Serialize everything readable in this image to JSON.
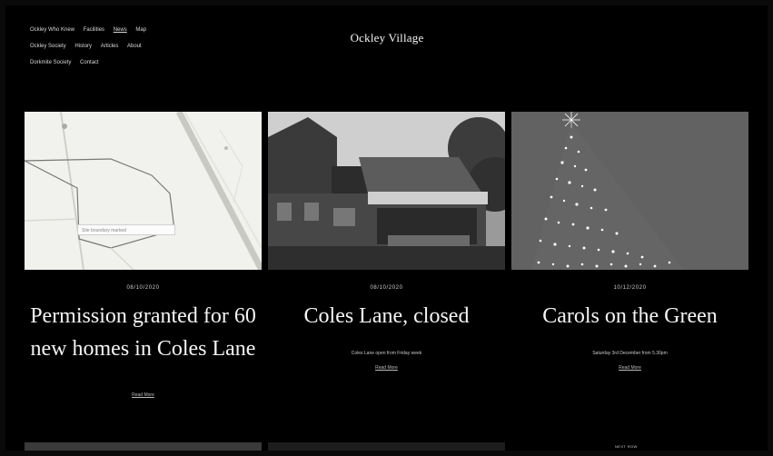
{
  "site": {
    "title": "Ockley Village"
  },
  "nav": {
    "items": [
      {
        "label": "Ockley Who Knew",
        "active": false
      },
      {
        "label": "Facilities",
        "active": false
      },
      {
        "label": "News",
        "active": true
      },
      {
        "label": "Map",
        "active": false
      },
      {
        "label": "Ockley Society",
        "active": false
      },
      {
        "label": "History",
        "active": false
      },
      {
        "label": "Articles",
        "active": false
      },
      {
        "label": "About",
        "active": false
      },
      {
        "label": "Dorkmite Society",
        "active": false
      },
      {
        "label": "Contact",
        "active": false
      }
    ]
  },
  "cards": [
    {
      "date": "08/10/2020",
      "headline": "Permission granted for 60 new homes in Coles Lane",
      "excerpt": "",
      "more": "Read More",
      "map_label": "Site boundary marked"
    },
    {
      "date": "08/10/2020",
      "headline": "Coles Lane, closed",
      "excerpt": "Coles Lane open from Friday week",
      "more": "Read More"
    },
    {
      "date": "10/12/2020",
      "headline": "Carols on the Green",
      "excerpt": "Saturday 3rd December from 5.30pm",
      "more": "Read More"
    }
  ],
  "bottom_row": {
    "label": "NEXT ROW"
  }
}
